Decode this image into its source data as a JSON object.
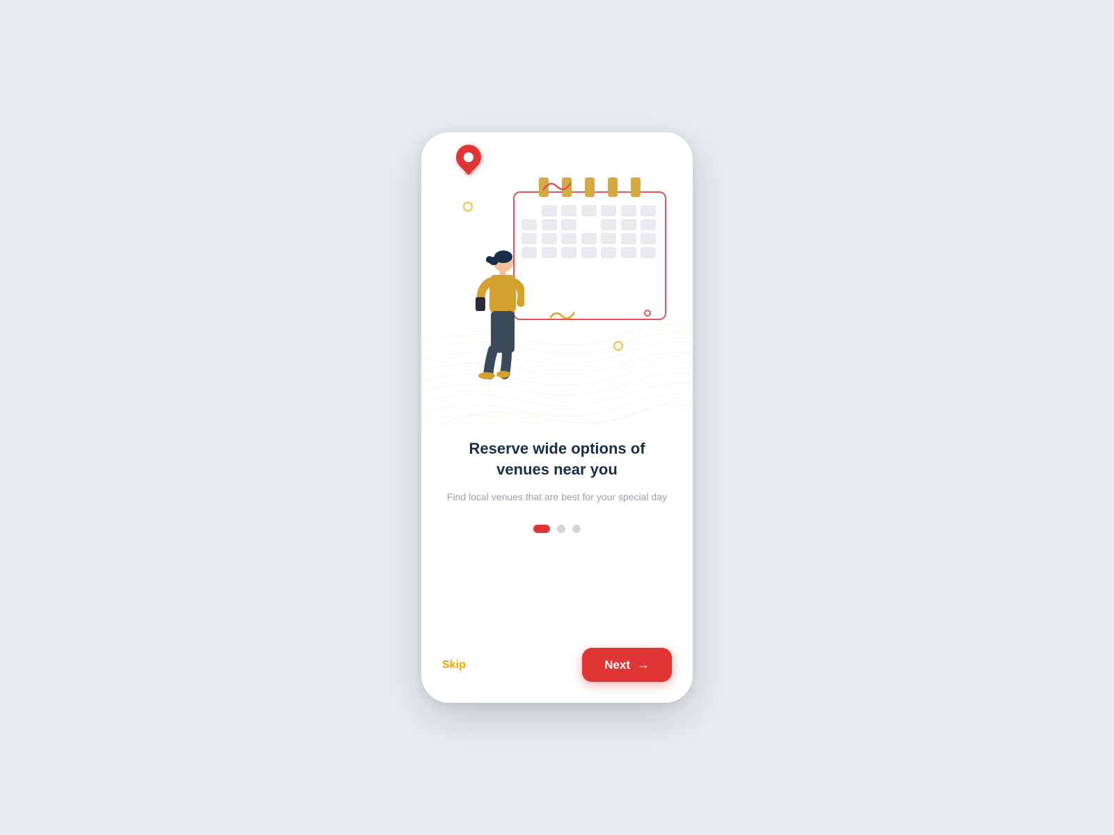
{
  "page": {
    "background_color": "#e8ecf0"
  },
  "illustration": {
    "calendar_rings_count": 5,
    "calendar_cells": 28
  },
  "content": {
    "title": "Reserve wide options of venues near you",
    "subtitle": "Find local venues that are best for your special day"
  },
  "dots": {
    "active_index": 0,
    "total": 3
  },
  "actions": {
    "skip_label": "Skip",
    "next_label": "Next"
  }
}
